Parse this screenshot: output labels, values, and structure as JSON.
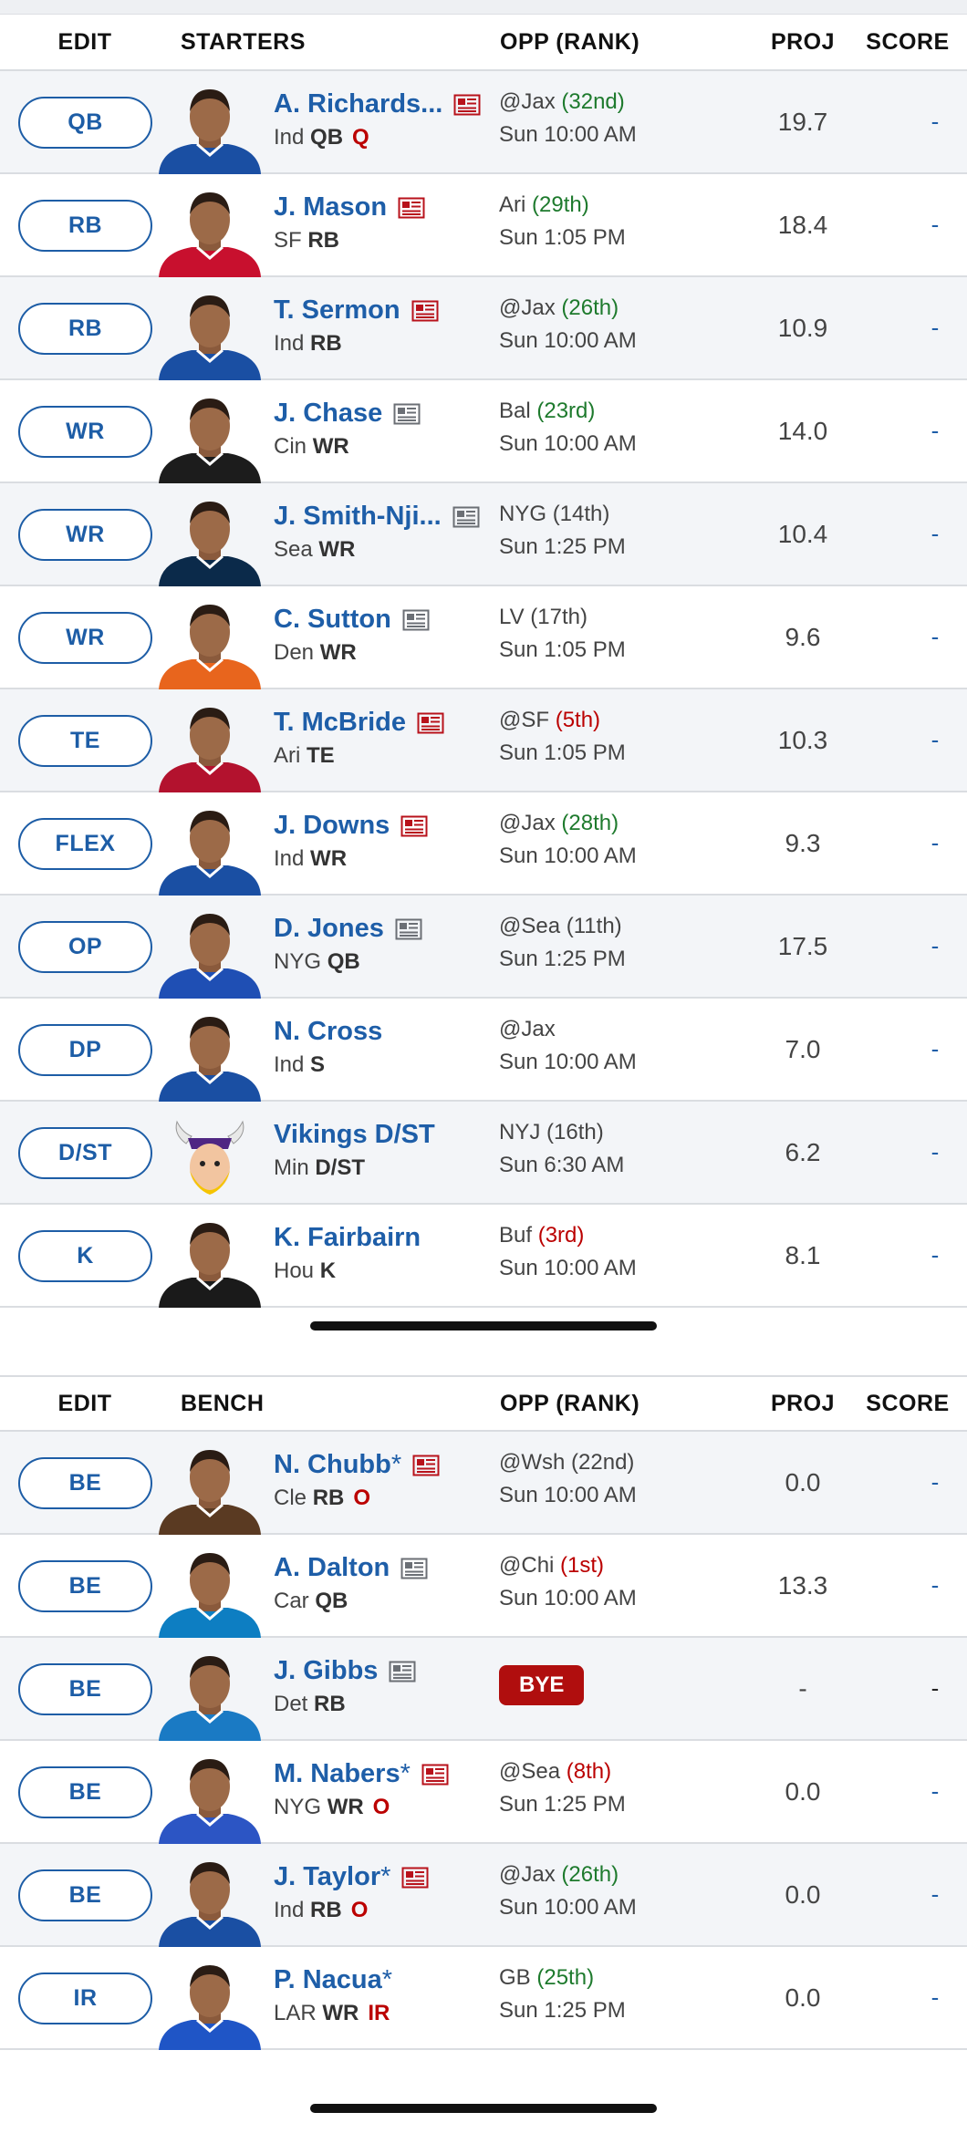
{
  "starters_header": {
    "edit": "EDIT",
    "section": "STARTERS",
    "opp": "OPP (RANK)",
    "proj": "PROJ",
    "score": "SCORE"
  },
  "bench_header": {
    "edit": "EDIT",
    "section": "BENCH",
    "opp": "OPP (RANK)",
    "proj": "PROJ",
    "score": "SCORE"
  },
  "starters": [
    {
      "slot": "QB",
      "name": "A. Richards...",
      "star": "",
      "team": "Ind",
      "pos": "QB",
      "status": "Q",
      "news": "red",
      "opp": "@Jax",
      "rank": "(32nd)",
      "rank_color": "green",
      "time": "Sun 10:00 AM",
      "proj": "19.7",
      "score": "-"
    },
    {
      "slot": "RB",
      "name": "J. Mason",
      "star": "",
      "team": "SF",
      "pos": "RB",
      "status": "",
      "news": "red",
      "opp": "Ari",
      "rank": "(29th)",
      "rank_color": "green",
      "time": "Sun 1:05 PM",
      "proj": "18.4",
      "score": "-"
    },
    {
      "slot": "RB",
      "name": "T. Sermon",
      "star": "",
      "team": "Ind",
      "pos": "RB",
      "status": "",
      "news": "red",
      "opp": "@Jax",
      "rank": "(26th)",
      "rank_color": "green",
      "time": "Sun 10:00 AM",
      "proj": "10.9",
      "score": "-"
    },
    {
      "slot": "WR",
      "name": "J. Chase",
      "star": "",
      "team": "Cin",
      "pos": "WR",
      "status": "",
      "news": "gray",
      "opp": "Bal",
      "rank": "(23rd)",
      "rank_color": "green",
      "time": "Sun 10:00 AM",
      "proj": "14.0",
      "score": "-"
    },
    {
      "slot": "WR",
      "name": "J. Smith-Nji...",
      "star": "",
      "team": "Sea",
      "pos": "WR",
      "status": "",
      "news": "gray",
      "opp": "NYG",
      "rank": "(14th)",
      "rank_color": "neutral",
      "time": "Sun 1:25 PM",
      "proj": "10.4",
      "score": "-"
    },
    {
      "slot": "WR",
      "name": "C. Sutton",
      "star": "",
      "team": "Den",
      "pos": "WR",
      "status": "",
      "news": "gray",
      "opp": "LV",
      "rank": "(17th)",
      "rank_color": "neutral",
      "time": "Sun 1:05 PM",
      "proj": "9.6",
      "score": "-"
    },
    {
      "slot": "TE",
      "name": "T. McBride",
      "star": "",
      "team": "Ari",
      "pos": "TE",
      "status": "",
      "news": "red",
      "opp": "@SF",
      "rank": "(5th)",
      "rank_color": "red",
      "time": "Sun 1:05 PM",
      "proj": "10.3",
      "score": "-"
    },
    {
      "slot": "FLEX",
      "name": "J. Downs",
      "star": "",
      "team": "Ind",
      "pos": "WR",
      "status": "",
      "news": "red",
      "opp": "@Jax",
      "rank": "(28th)",
      "rank_color": "green",
      "time": "Sun 10:00 AM",
      "proj": "9.3",
      "score": "-"
    },
    {
      "slot": "OP",
      "name": "D. Jones",
      "star": "",
      "team": "NYG",
      "pos": "QB",
      "status": "",
      "news": "gray",
      "opp": "@Sea",
      "rank": "(11th)",
      "rank_color": "neutral",
      "time": "Sun 1:25 PM",
      "proj": "17.5",
      "score": "-"
    },
    {
      "slot": "DP",
      "name": "N. Cross",
      "star": "",
      "team": "Ind",
      "pos": "S",
      "status": "",
      "news": "none",
      "opp": "@Jax",
      "rank": "",
      "rank_color": "neutral",
      "time": "Sun 10:00 AM",
      "proj": "7.0",
      "score": "-"
    },
    {
      "slot": "D/ST",
      "name": "Vikings D/ST",
      "star": "",
      "team": "Min",
      "pos": "D/ST",
      "status": "",
      "news": "none",
      "opp": "NYJ",
      "rank": "(16th)",
      "rank_color": "neutral",
      "time": "Sun 6:30 AM",
      "proj": "6.2",
      "score": "-"
    },
    {
      "slot": "K",
      "name": "K. Fairbairn",
      "star": "",
      "team": "Hou",
      "pos": "K",
      "status": "",
      "news": "none",
      "opp": "Buf",
      "rank": "(3rd)",
      "rank_color": "red",
      "time": "Sun 10:00 AM",
      "proj": "8.1",
      "score": "-"
    }
  ],
  "bench": [
    {
      "slot": "BE",
      "name": "N. Chubb",
      "star": "*",
      "team": "Cle",
      "pos": "RB",
      "status": "O",
      "news": "red",
      "opp": "@Wsh",
      "rank": "(22nd)",
      "rank_color": "neutral",
      "time": "Sun 10:00 AM",
      "proj": "0.0",
      "score": "-"
    },
    {
      "slot": "BE",
      "name": "A. Dalton",
      "star": "",
      "team": "Car",
      "pos": "QB",
      "status": "",
      "news": "gray",
      "opp": "@Chi",
      "rank": "(1st)",
      "rank_color": "red",
      "time": "Sun 10:00 AM",
      "proj": "13.3",
      "score": "-"
    },
    {
      "slot": "BE",
      "name": "J. Gibbs",
      "star": "",
      "team": "Det",
      "pos": "RB",
      "status": "",
      "news": "gray",
      "opp": "",
      "rank": "",
      "rank_color": "neutral",
      "time": "",
      "bye": "BYE",
      "proj": "-",
      "score": "-"
    },
    {
      "slot": "BE",
      "name": "M. Nabers",
      "star": "*",
      "team": "NYG",
      "pos": "WR",
      "status": "O",
      "news": "red",
      "opp": "@Sea",
      "rank": "(8th)",
      "rank_color": "red",
      "time": "Sun 1:25 PM",
      "proj": "0.0",
      "score": "-"
    },
    {
      "slot": "BE",
      "name": "J. Taylor",
      "star": "*",
      "team": "Ind",
      "pos": "RB",
      "status": "O",
      "news": "red",
      "opp": "@Jax",
      "rank": "(26th)",
      "rank_color": "green",
      "time": "Sun 10:00 AM",
      "proj": "0.0",
      "score": "-"
    },
    {
      "slot": "IR",
      "name": "P. Nacua",
      "star": "*",
      "team": "LAR",
      "pos": "WR",
      "status": "IR",
      "news": "none",
      "opp": "GB",
      "rank": "(25th)",
      "rank_color": "green",
      "time": "Sun 1:25 PM",
      "proj": "0.0",
      "score": "-"
    }
  ],
  "jersey_colors": {
    "starters": [
      "#1a4fa3",
      "#c8102e",
      "#1a4fa3",
      "#1c1c1c",
      "#0b2a4a",
      "#e8651d",
      "#b3122e",
      "#1a4fa3",
      "#1f4fb4",
      "#1a4fa3",
      "#4f2683",
      "#1a1a1a"
    ],
    "bench": [
      "#5a3a22",
      "#0d7ec2",
      "#1a7ac4",
      "#2c55c4",
      "#1a4fa3",
      "#1f55c6"
    ]
  },
  "icons": {
    "news": "news-article-icon",
    "headshot": "player-headshot",
    "logo": "vikings-logo"
  }
}
